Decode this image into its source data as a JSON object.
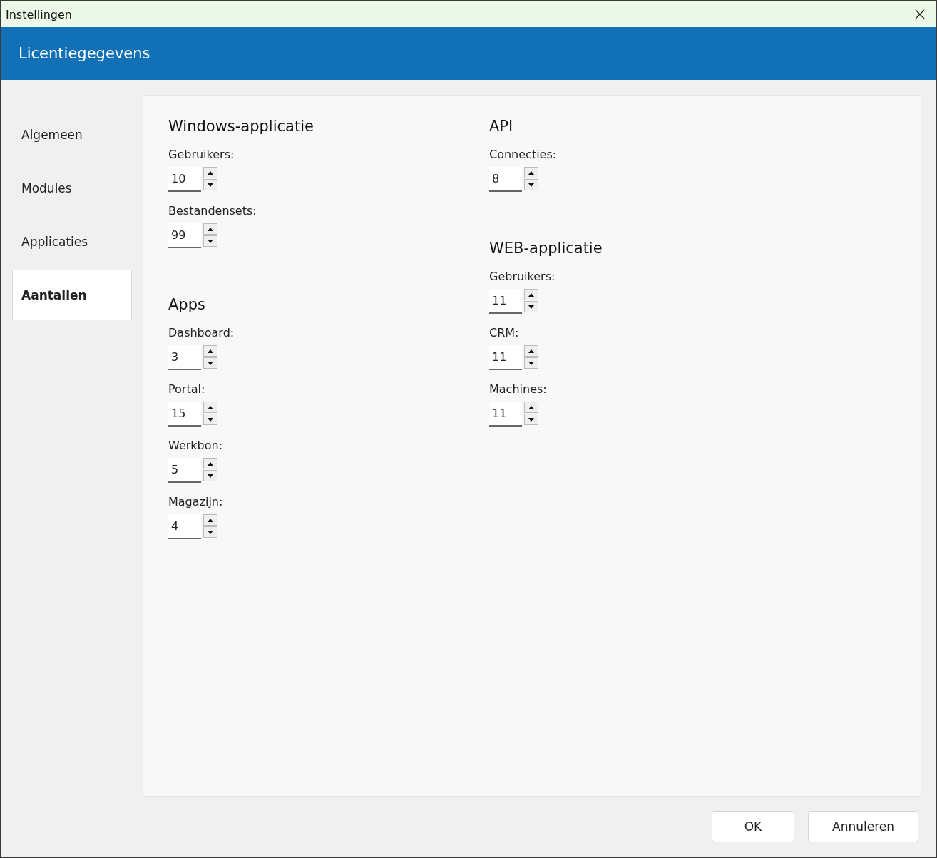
{
  "window": {
    "title": "Instellingen"
  },
  "header": {
    "title": "Licentiegegevens"
  },
  "sidebar": {
    "items": [
      {
        "label": "Algemeen",
        "selected": false
      },
      {
        "label": "Modules",
        "selected": false
      },
      {
        "label": "Applicaties",
        "selected": false
      },
      {
        "label": "Aantallen",
        "selected": true
      }
    ]
  },
  "columns": [
    {
      "sections": [
        {
          "title": "Windows-applicatie",
          "fields": [
            {
              "label": "Gebruikers:",
              "value": "10"
            },
            {
              "label": "Bestandensets:",
              "value": "99"
            }
          ]
        },
        {
          "title": "Apps",
          "fields": [
            {
              "label": "Dashboard:",
              "value": "3"
            },
            {
              "label": "Portal:",
              "value": "15"
            },
            {
              "label": "Werkbon:",
              "value": "5"
            },
            {
              "label": "Magazijn:",
              "value": "4"
            }
          ]
        }
      ]
    },
    {
      "sections": [
        {
          "title": "API",
          "fields": [
            {
              "label": "Connecties:",
              "value": "8"
            }
          ]
        },
        {
          "title": "WEB-applicatie",
          "fields": [
            {
              "label": "Gebruikers:",
              "value": "11"
            },
            {
              "label": "CRM:",
              "value": "11"
            },
            {
              "label": "Machines:",
              "value": "11"
            }
          ]
        }
      ]
    }
  ],
  "buttons": [
    "OK",
    "Annuleren"
  ]
}
